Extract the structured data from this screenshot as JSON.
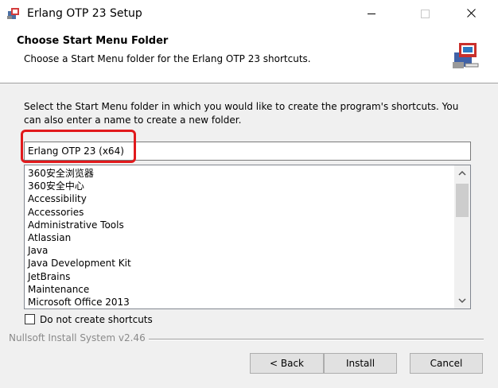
{
  "window": {
    "title": "Erlang OTP 23 Setup"
  },
  "header": {
    "title": "Choose Start Menu Folder",
    "subtitle": "Choose a Start Menu folder for the Erlang OTP 23 shortcuts."
  },
  "instructions": "Select the Start Menu folder in which you would like to create the program's shortcuts. You can also enter a name to create a new folder.",
  "folder_input": {
    "value": "Erlang OTP 23 (x64)"
  },
  "folder_list": {
    "items": [
      "360安全浏览器",
      "360安全中心",
      "Accessibility",
      "Accessories",
      "Administrative Tools",
      "Atlassian",
      "Java",
      "Java Development Kit",
      "JetBrains",
      "Maintenance",
      "Microsoft Office 2013"
    ]
  },
  "checkbox": {
    "label": "Do not create shortcuts",
    "checked": false
  },
  "footer": {
    "branding": "Nullsoft Install System v2.46"
  },
  "buttons": {
    "back": "< Back",
    "install": "Install",
    "cancel": "Cancel"
  },
  "colors": {
    "highlight": "#e1191c",
    "window_bg": "#f0f0f0",
    "header_bg": "#ffffff"
  }
}
